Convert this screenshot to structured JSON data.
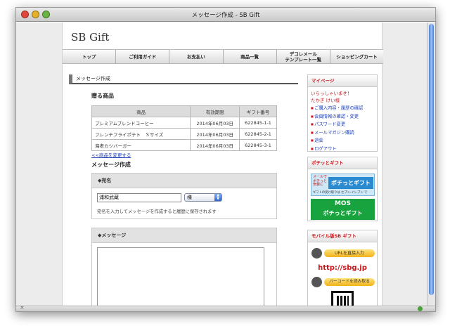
{
  "window": {
    "title": "メッセージ作成 - SB Gift",
    "colors": {
      "close": "#e4453b",
      "minimize": "#e5b128",
      "zoom": "#69b443"
    }
  },
  "logo": "SB Gift",
  "nav": [
    "トップ",
    "ご利用ガイド",
    "お支払い",
    "商品一覧",
    "デコレメール\nテンプレート一覧",
    "ショッピングカート"
  ],
  "section_title": "メッセージ作成",
  "gift_items": {
    "heading": "贈る商品",
    "columns": [
      "商品",
      "有効期限",
      "ギフト番号"
    ],
    "rows": [
      [
        "プレミアムブレンドコーヒー",
        "2014年06月03日",
        "622845-1-1"
      ],
      [
        "フレンチフライポテト　Ｓサイズ",
        "2014年06月03日",
        "622845-2-1"
      ],
      [
        "海老カツバーガー",
        "2014年06月03日",
        "622845-3-1"
      ]
    ],
    "change_link": "<<商品を変更する"
  },
  "message_form": {
    "heading": "メッセージ作成",
    "recipient_label": "◆宛名",
    "recipient_value": "浦和武蔵",
    "honorific": "様",
    "note": "宛名を入力してメッセージを作成すると履歴に保存されます",
    "message_label": "◆メッセージ"
  },
  "mypage": {
    "title": "マイページ",
    "welcome": "いらっしゃいませ！",
    "user": "たかぎ けい様",
    "links": [
      "ご購入内容・履歴の確認",
      "会員情報の確認・変更",
      "パスワード変更",
      "メールマガジン購読",
      "退会",
      "ログアウト"
    ]
  },
  "pochi": {
    "title": "ポチッとギフト",
    "banner1": {
      "brand": "ポチっとギフト",
      "side_text": "メールで\nポチっと\n気軽に",
      "footer": "ギフトの受け取りは セブン-イレブン で"
    },
    "banner2": {
      "logo": "MOS",
      "brand": "ポチっとギフト"
    }
  },
  "mobile": {
    "title": "モバイル版SB ギフト",
    "url_button": "URLを直接入力",
    "url": "http://sbg.jp",
    "barcode_button": "バーコードを読み取る"
  }
}
